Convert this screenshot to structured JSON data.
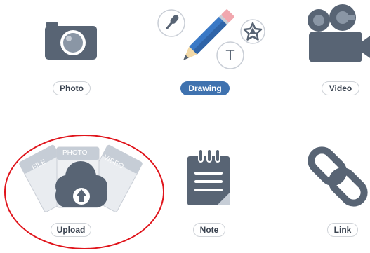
{
  "options": [
    {
      "id": "photo",
      "label": "Photo",
      "icon": "camera-icon",
      "selected": false
    },
    {
      "id": "drawing",
      "label": "Drawing",
      "icon": "pencil-icon",
      "selected": true
    },
    {
      "id": "video",
      "label": "Video",
      "icon": "video-camera-icon",
      "selected": false
    },
    {
      "id": "upload",
      "label": "Upload",
      "icon": "cloud-upload-icon",
      "selected": false
    },
    {
      "id": "note",
      "label": "Note",
      "icon": "notepad-icon",
      "selected": false
    },
    {
      "id": "link",
      "label": "Link",
      "icon": "chain-link-icon",
      "selected": false
    }
  ],
  "upload_cards": {
    "file": "FILE",
    "photo": "PHOTO",
    "video": "VIDEO"
  },
  "drawing_badge_text": "T",
  "colors": {
    "icon_slate": "#586474",
    "icon_slate_light": "#8a96a5",
    "selected_pill": "#3f72af",
    "pencil_blue": "#3a79c6",
    "pencil_tip": "#f3d9a6",
    "pencil_eraser": "#f1a7ae",
    "annotation_red": "#e0141b"
  }
}
